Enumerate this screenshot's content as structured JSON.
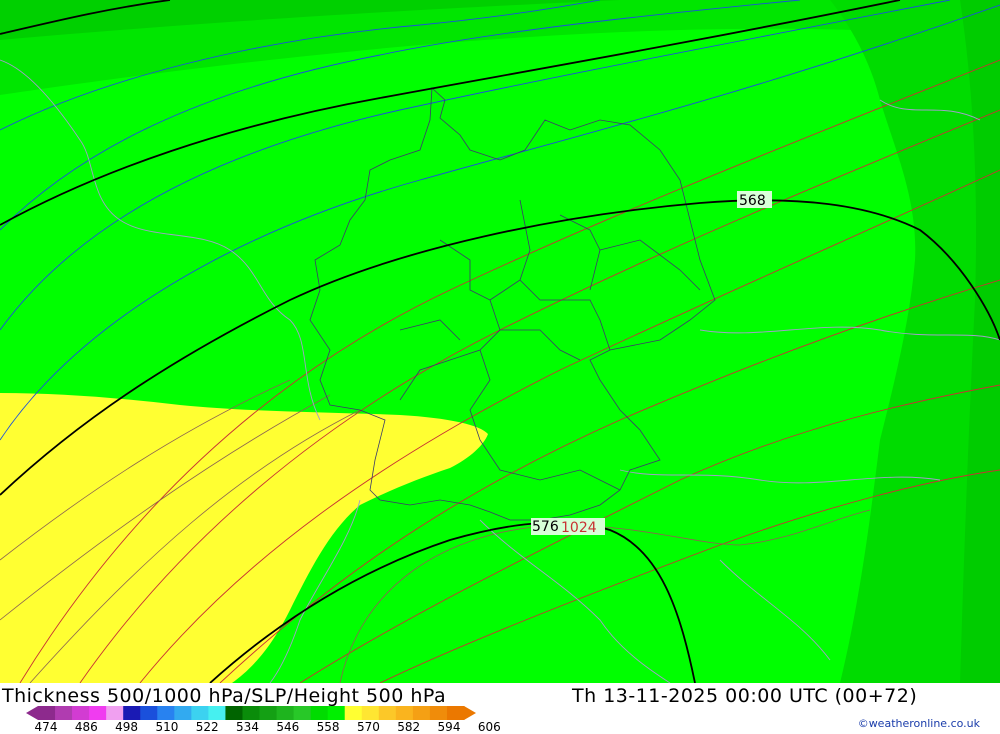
{
  "title": {
    "left": "Thickness 500/1000 hPa/SLP/Height 500 hPa",
    "right": "Th 13-11-2025 00:00 UTC (00+72)"
  },
  "credit": "©weatheronline.co.uk",
  "contour_labels": {
    "height_568": "568",
    "height_576": "576",
    "slp_1024": "1024"
  },
  "legend": {
    "ticks": [
      "474",
      "486",
      "498",
      "510",
      "522",
      "534",
      "546",
      "558",
      "570",
      "582",
      "594",
      "606"
    ],
    "colors": [
      "#8d2a8d",
      "#b03cb0",
      "#d23cd2",
      "#f03cf0",
      "#f0a0f0",
      "#1a1ab4",
      "#1a50dc",
      "#2882f0",
      "#32aaf0",
      "#3cd2f0",
      "#46f0f0",
      "#006400",
      "#0a8c0a",
      "#14a014",
      "#1eb41e",
      "#28c828",
      "#00dc00",
      "#00f000",
      "#ffff32",
      "#ffe632",
      "#fcc828",
      "#fab41e",
      "#f5a014",
      "#f08c0a",
      "#eb7800"
    ]
  },
  "colors": {
    "zone_546": "#00c800",
    "zone_552": "#00dc00",
    "zone_558": "#00ff00",
    "zone_564": "#ffff32",
    "height_contour": "#000000",
    "thickness_cold": "#1a50dc",
    "thickness_warm": "#c83232",
    "slp_isobar": "#8c6450",
    "borders": "#a0a0c8",
    "coast": "#3c3c3c"
  }
}
